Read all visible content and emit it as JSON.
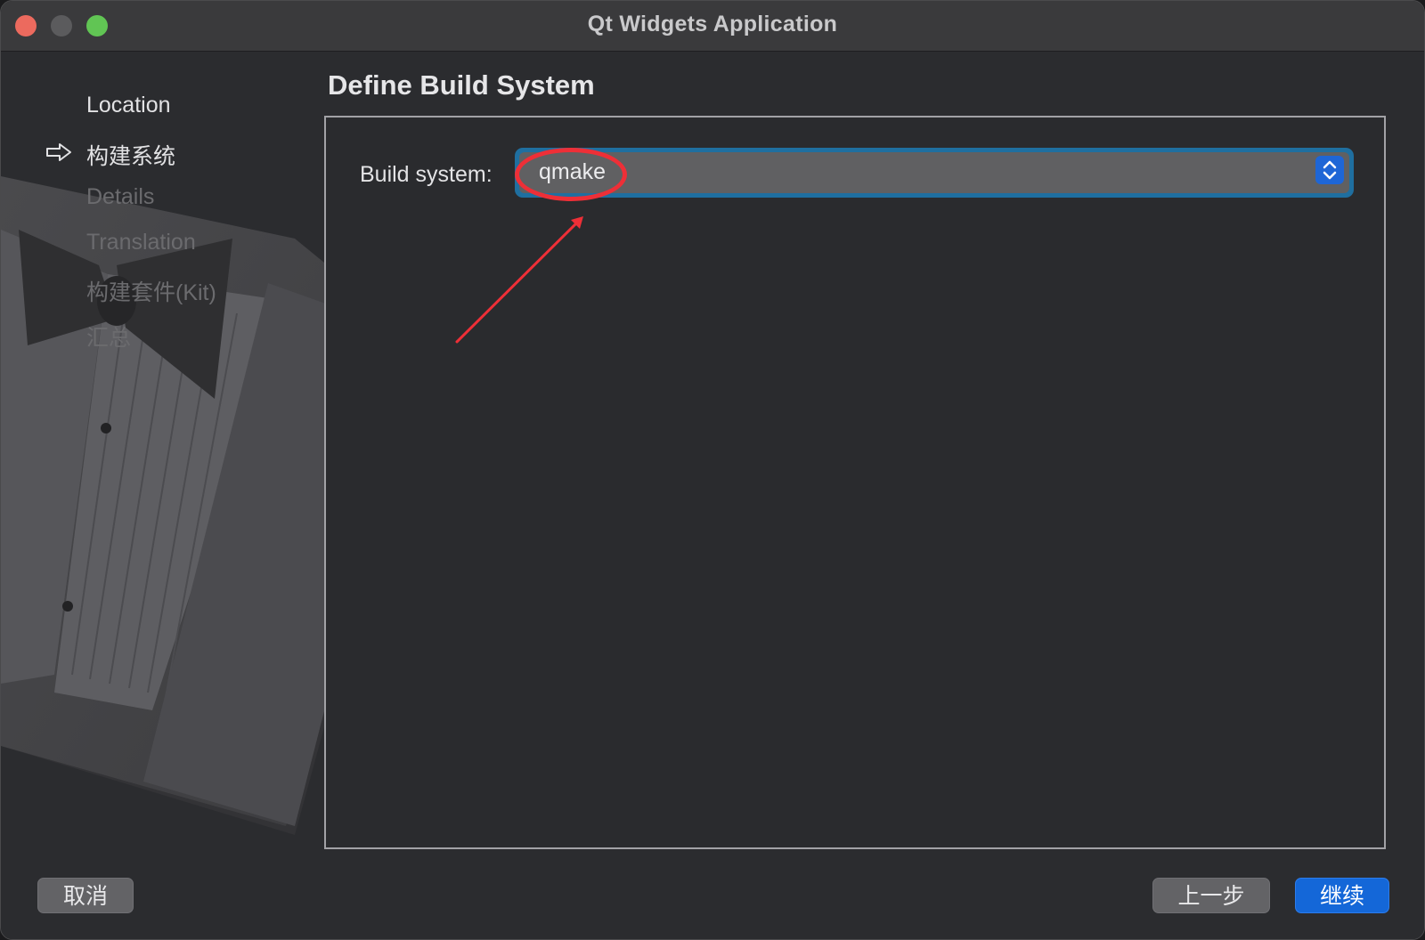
{
  "window": {
    "title": "Qt Widgets Application"
  },
  "sidebar": {
    "steps": [
      {
        "label": "Location",
        "state": "done"
      },
      {
        "label": "构建系统",
        "state": "current"
      },
      {
        "label": "Details",
        "state": "pending"
      },
      {
        "label": "Translation",
        "state": "pending"
      },
      {
        "label": "构建套件(Kit)",
        "state": "pending"
      },
      {
        "label": "汇总",
        "state": "pending"
      }
    ],
    "current_icon": "right-arrow-outline-icon"
  },
  "page": {
    "title": "Define Build System"
  },
  "form": {
    "build_system_label": "Build system:",
    "build_system_value": "qmake",
    "stepper_icon": "updown-chevron-icon"
  },
  "annotation": {
    "color": "#ee2f37",
    "shapes": [
      "ellipse",
      "arrow"
    ]
  },
  "buttons": {
    "cancel": "取消",
    "back": "上一步",
    "next": "继续"
  },
  "colors": {
    "accent": "#1467d8",
    "focus_ring": "#1f6fa0",
    "close": "#ec6a5e",
    "maximize": "#61c554"
  }
}
